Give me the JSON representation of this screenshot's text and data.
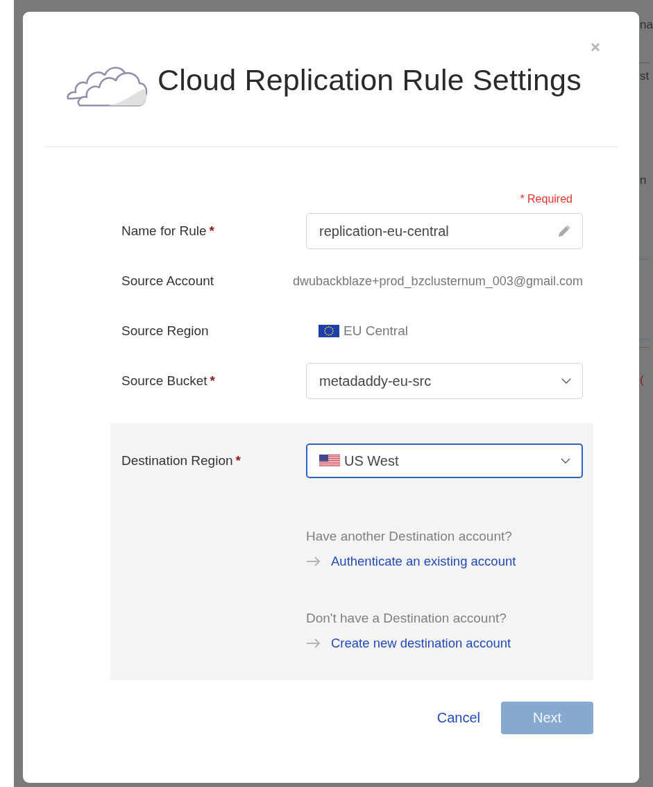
{
  "background_page": {
    "texts": [
      "na",
      "st",
      "n",
      "("
    ]
  },
  "dialog": {
    "title": "Cloud Replication Rule Settings",
    "required_note": "* Required",
    "required_mark": "*",
    "fields": [
      {
        "kind": "text-input",
        "label": "Name for Rule",
        "required": true,
        "value": "replication-eu-central"
      },
      {
        "kind": "static",
        "label": "Source Account",
        "required": false,
        "value": "dwubackblaze+prod_bzclusternum_003@gmail.com"
      },
      {
        "kind": "region",
        "label": "Source Region",
        "required": false,
        "value": "EU Central",
        "flag": {
          "kind": "eu"
        }
      },
      {
        "kind": "select",
        "label": "Source Bucket",
        "required": true,
        "value": "metadaddy-eu-src"
      }
    ],
    "destination": {
      "label": "Destination Region",
      "required": true,
      "value": "US West",
      "flag": {
        "kind": "us"
      },
      "focused": true,
      "options": [
        {
          "prompt": "Have another Destination account?",
          "link": "Authenticate an existing account"
        },
        {
          "prompt": "Don't have a Destination account?",
          "link": "Create new destination account"
        }
      ]
    },
    "buttons": {
      "cancel": "Cancel",
      "next": {
        "label": "Next",
        "disabled": true
      }
    }
  }
}
